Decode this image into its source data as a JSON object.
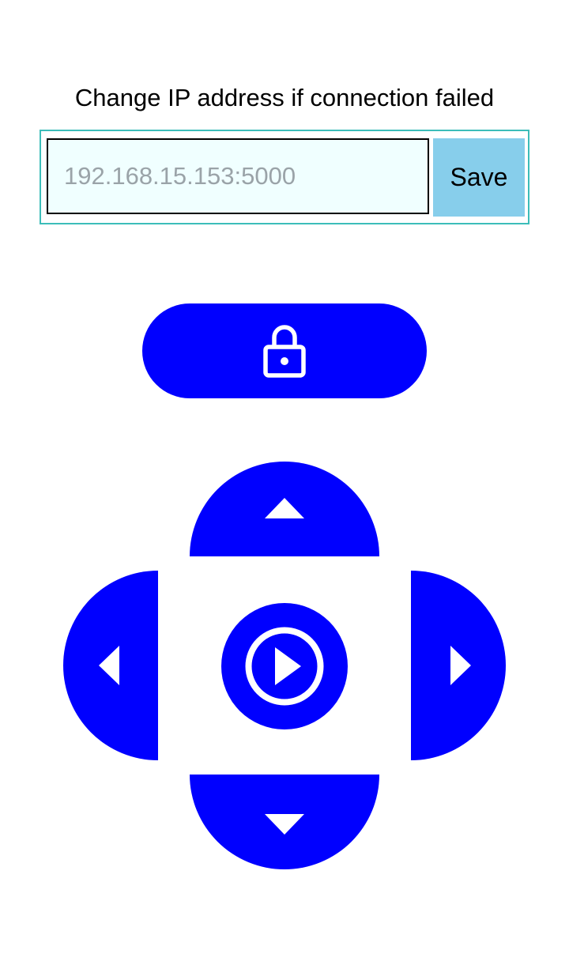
{
  "header": {
    "instruction": "Change IP address if connection failed"
  },
  "ip_form": {
    "placeholder": "192.168.15.153:5000",
    "value": "",
    "save_label": "Save"
  },
  "controls": {
    "lock_icon": "lock-icon",
    "up_icon": "triangle-up-icon",
    "down_icon": "triangle-down-icon",
    "left_icon": "triangle-left-icon",
    "right_icon": "triangle-right-icon",
    "center_icon": "play-circle-icon"
  },
  "colors": {
    "control_blue": "#0000ff",
    "input_background": "#f0ffff",
    "save_background": "#87ceeb",
    "frame_border": "#3cbdb9"
  }
}
